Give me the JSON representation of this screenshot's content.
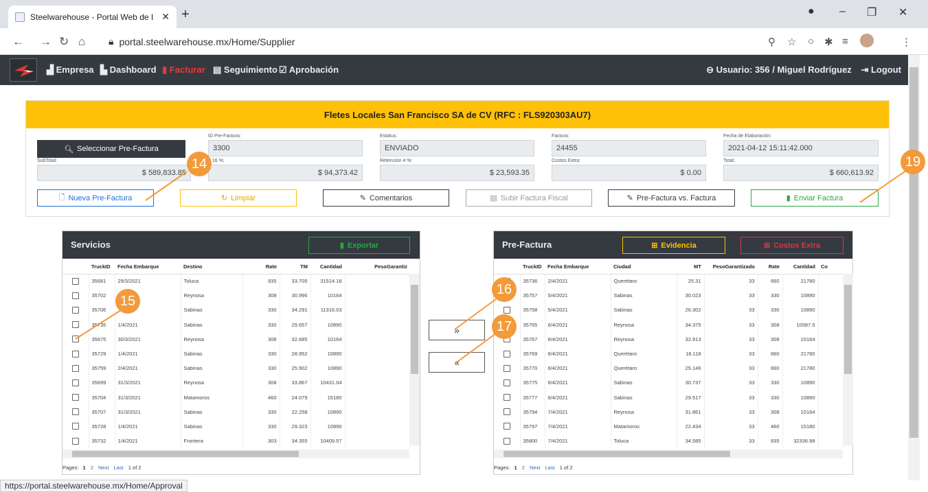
{
  "browser": {
    "tab_title": "Steelwarehouse - Portal Web de I",
    "url": "portal.steelwarehouse.mx/Home/Supplier",
    "status_url": "https://portal.steelwarehouse.mx/Home/Approval"
  },
  "navbar": {
    "empresa": "Empresa",
    "dashboard": "Dashboard",
    "facturar": "Facturar",
    "seguimiento": "Seguimiento",
    "aprobacion": "Aprobación",
    "user": "Usuario: 356 / Miguel Rodríguez",
    "logout": "Logout",
    "active_color": "#e23a3a"
  },
  "header": {
    "title": "Fletes Locales San Francisco SA de CV (RFC : FLS920303AU7)",
    "select_btn": "Seleccionar Pre-Factura",
    "id_label": "ID Pre-Factura:",
    "id_value": "3300",
    "estatus_label": "Estatus:",
    "estatus_value": "ENVIADO",
    "factura_label": "Factura:",
    "factura_value": "24455",
    "fecha_label": "Fecha de Elaboración:",
    "fecha_value": "2021-04-12 15:11:42.000",
    "subtotal_label": "SubTotal:",
    "subtotal_value": "$ 589,833.85",
    "iva_label": "a 16 %:",
    "iva_value": "$ 94,373.42",
    "ret_label": "Retención 4 %:",
    "ret_value": "$ 23,593.35",
    "costos_label": "Costos Extra:",
    "costos_value": "$ 0.00",
    "total_label": "Total:",
    "total_value": "$ 660,613.92"
  },
  "actions": {
    "nueva": "Nueva Pre-Factura",
    "limpiar": "Limpiar",
    "comentarios": "Comentarios",
    "subir": "Subir Factura Fiscal",
    "comparar": "Pre-Factura vs. Factura",
    "enviar": "Enviar Factura"
  },
  "servicios": {
    "title": "Servicios",
    "exportar": "Exportar",
    "columns": [
      "TruckID",
      "Fecha Embarque",
      "Destino",
      "Rate",
      "TM",
      "Cantidad",
      "PesoGarantiz"
    ],
    "rows": [
      [
        "35681",
        "29/3/2021",
        "Toluca",
        "935",
        "33.705",
        "31514.18"
      ],
      [
        "35702",
        "",
        "Reynosa",
        "308",
        "30.996",
        "10164"
      ],
      [
        "35706",
        "",
        "Sabinas",
        "330",
        "34.291",
        "11316.03"
      ],
      [
        "35735",
        "1/4/2021",
        "Sabinas",
        "330",
        "29.657",
        "10890"
      ],
      [
        "35675",
        "30/3/2021",
        "Reynosa",
        "308",
        "32.685",
        "10164"
      ],
      [
        "35729",
        "1/4/2021",
        "Sabinas",
        "330",
        "28.952",
        "10890"
      ],
      [
        "35759",
        "2/4/2021",
        "Sabinas",
        "330",
        "25.902",
        "10890"
      ],
      [
        "35699",
        "31/3/2021",
        "Reynosa",
        "308",
        "33.867",
        "10431.04"
      ],
      [
        "35704",
        "31/3/2021",
        "Matamoros",
        "460",
        "24.079",
        "15180"
      ],
      [
        "35707",
        "31/3/2021",
        "Sabinas",
        "330",
        "22.258",
        "10890"
      ],
      [
        "35728",
        "1/4/2021",
        "Sabinas",
        "330",
        "29.323",
        "10890"
      ],
      [
        "35732",
        "1/4/2021",
        "Frontera",
        "303",
        "34.355",
        "10409.57"
      ]
    ],
    "pager": {
      "label": "Pages:",
      "p1": "1",
      "p2": "2",
      "next": "Next",
      "last": "Last",
      "of": "1 of 2"
    }
  },
  "prefactura": {
    "title": "Pre-Factura",
    "evidencia": "Evidencia",
    "costos": "Costos Extra",
    "columns": [
      "TruckID",
      "Fecha Embarque",
      "Ciudad",
      "MT",
      "PesoGarantizado",
      "Rate",
      "Cantidad",
      "Co"
    ],
    "rows": [
      [
        "35736",
        "2/4/2021",
        "Querétaro",
        "25.31",
        "33",
        "660",
        "21780"
      ],
      [
        "35757",
        "5/4/2021",
        "Sabinas",
        "30.023",
        "33",
        "330",
        "10890"
      ],
      [
        "35758",
        "5/4/2021",
        "Sabinas",
        "26.302",
        "33",
        "330",
        "10890"
      ],
      [
        "35765",
        "6/4/2021",
        "Reynosa",
        "34.375",
        "33",
        "308",
        "10587.5"
      ],
      [
        "35767",
        "6/4/2021",
        "Reynosa",
        "32.913",
        "33",
        "308",
        "10164"
      ],
      [
        "35769",
        "6/4/2021",
        "Querétaro",
        "18.118",
        "33",
        "660",
        "21780"
      ],
      [
        "35770",
        "6/4/2021",
        "Querétaro",
        "25.146",
        "33",
        "660",
        "21780"
      ],
      [
        "35775",
        "6/4/2021",
        "Sabinas",
        "30.737",
        "33",
        "330",
        "10890"
      ],
      [
        "35777",
        "6/4/2021",
        "Sabinas",
        "29.517",
        "33",
        "330",
        "10890"
      ],
      [
        "35794",
        "7/4/2021",
        "Reynosa",
        "31.861",
        "33",
        "308",
        "10164"
      ],
      [
        "35797",
        "7/4/2021",
        "Matamoros",
        "22.434",
        "33",
        "460",
        "15180"
      ],
      [
        "35800",
        "7/4/2021",
        "Toluca",
        "34.585",
        "33",
        "935",
        "32336.98"
      ]
    ],
    "pager": {
      "label": "Pages:",
      "p1": "1",
      "p2": "2",
      "next": "Next",
      "last": "Last",
      "of": "1 of 2"
    }
  },
  "move": {
    "right": "»",
    "left": "«"
  },
  "badges": {
    "b14": "14",
    "b15": "15",
    "b16": "16",
    "b17": "17",
    "b19": "19"
  },
  "colors": {
    "primary": "#1e6fd9",
    "warning": "#ffc107",
    "success": "#28a745",
    "danger": "#dc3545",
    "badge": "#f39a3a"
  }
}
